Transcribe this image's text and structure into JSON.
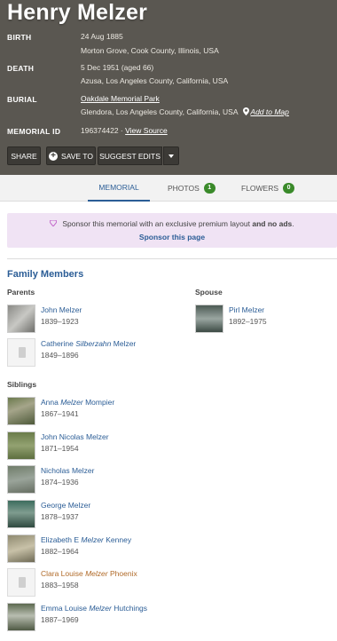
{
  "memorial": {
    "name": "Henry Melzer",
    "birth_label": "BIRTH",
    "birth_date": "24 Aug 1885",
    "birth_place": "Morton Grove, Cook County, Illinois, USA",
    "death_label": "DEATH",
    "death_date": "5 Dec 1951 (aged 66)",
    "death_place": "Azusa, Los Angeles County, California, USA",
    "burial_label": "BURIAL",
    "burial_cemetery": "Oakdale Memorial Park",
    "burial_place": "Glendora, Los Angeles County, California, USA",
    "add_to_map": "Add to Map",
    "id_label": "MEMORIAL ID",
    "id_value": "196374422",
    "id_separator": "·",
    "view_source": "View Source"
  },
  "actions": {
    "share": "SHARE",
    "save_to": "SAVE TO",
    "suggest_edits": "SUGGEST EDITS"
  },
  "tabs": [
    {
      "label": "MEMORIAL",
      "count": ""
    },
    {
      "label": "PHOTOS",
      "count": "1"
    },
    {
      "label": "FLOWERS",
      "count": "0"
    }
  ],
  "sponsor": {
    "text": "Sponsor this memorial with an exclusive premium layout",
    "text_and": "and no ads",
    "text_end": ".",
    "link": "Sponsor this page"
  },
  "family": {
    "title": "Family Members",
    "parents_label": "Parents",
    "spouse_label": "Spouse",
    "siblings_label": "Siblings",
    "parents": [
      {
        "first": "John Melzer",
        "mid": "",
        "last": "",
        "dates": "1839–1923"
      },
      {
        "first": "Catherine ",
        "mid": "Silberzahn",
        "last": " Melzer",
        "dates": "1849–1896"
      }
    ],
    "spouse": [
      {
        "first": "Pirl Melzer",
        "mid": "",
        "last": "",
        "dates": "1892–1975"
      }
    ],
    "siblings": [
      {
        "first": "Anna ",
        "mid": "Melzer",
        "last": " Mompier",
        "dates": "1867–1941"
      },
      {
        "first": "John Nicolas Melzer",
        "mid": "",
        "last": "",
        "dates": "1871–1954"
      },
      {
        "first": "Nicholas Melzer",
        "mid": "",
        "last": "",
        "dates": "1874–1936"
      },
      {
        "first": "George Melzer",
        "mid": "",
        "last": "",
        "dates": "1878–1937"
      },
      {
        "first": "Elizabeth E ",
        "mid": "Melzer",
        "last": " Kenney",
        "dates": "1882–1964"
      },
      {
        "first": "Clara Louise ",
        "mid": "Melzer",
        "last": " Phoenix",
        "dates": "1883–1958"
      },
      {
        "first": "Emma Louise ",
        "mid": "Melzer",
        "last": " Hutchings",
        "dates": "1887–1969"
      }
    ]
  },
  "colors": {
    "header_bg": "#5a5751",
    "link": "#2b5d96",
    "count_badge": "#3a8a2a",
    "sponsor_bg": "#f0e3f4"
  }
}
